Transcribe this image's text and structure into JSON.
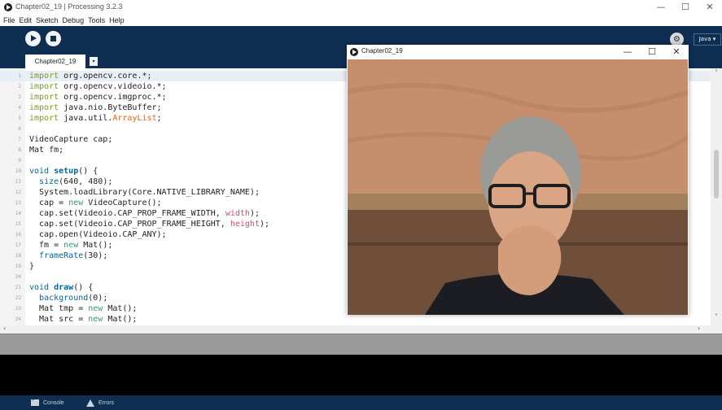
{
  "window": {
    "title": "Chapter02_19 | Processing 3.2.3",
    "controls": {
      "minimize": "—",
      "maximize": "☐",
      "close": "✕"
    }
  },
  "menu": [
    "File",
    "Edit",
    "Sketch",
    "Debug",
    "Tools",
    "Help"
  ],
  "toolbar": {
    "run_icon": "play-icon",
    "stop_icon": "stop-icon",
    "debug_icon": "debug-icon",
    "mode_label": "Java ▾"
  },
  "tabs": {
    "active": "Chapter02_19",
    "menu_arrow": "▾"
  },
  "editor": {
    "lines": [
      {
        "n": "1",
        "tokens": [
          [
            "import",
            "import"
          ],
          [
            " org.opencv.core.*;",
            ""
          ]
        ]
      },
      {
        "n": "2",
        "tokens": [
          [
            "import",
            "import"
          ],
          [
            " org.opencv.videoio.*;",
            ""
          ]
        ]
      },
      {
        "n": "3",
        "tokens": [
          [
            "import",
            "import"
          ],
          [
            " org.opencv.imgproc.*;",
            ""
          ]
        ]
      },
      {
        "n": "4",
        "tokens": [
          [
            "import",
            "import"
          ],
          [
            " java.nio.ByteBuffer;",
            ""
          ]
        ]
      },
      {
        "n": "5",
        "tokens": [
          [
            "import",
            "import"
          ],
          [
            " java.util.",
            ""
          ],
          [
            "ArrayList",
            "type"
          ],
          [
            ";",
            ""
          ]
        ]
      },
      {
        "n": "6",
        "tokens": []
      },
      {
        "n": "7",
        "tokens": [
          [
            "VideoCapture cap;",
            ""
          ]
        ]
      },
      {
        "n": "8",
        "tokens": [
          [
            "Mat fm;",
            ""
          ]
        ]
      },
      {
        "n": "9",
        "tokens": []
      },
      {
        "n": "10",
        "tokens": [
          [
            "void",
            "call"
          ],
          [
            " ",
            ""
          ],
          [
            "setup",
            "func"
          ],
          [
            "() {",
            ""
          ]
        ]
      },
      {
        "n": "11",
        "tokens": [
          [
            "  ",
            ""
          ],
          [
            "size",
            "call"
          ],
          [
            "(640, 480);",
            ""
          ]
        ]
      },
      {
        "n": "12",
        "tokens": [
          [
            "  System.loadLibrary(Core.NATIVE_LIBRARY_NAME);",
            ""
          ]
        ]
      },
      {
        "n": "13",
        "tokens": [
          [
            "  cap = ",
            ""
          ],
          [
            "new",
            "new"
          ],
          [
            " VideoCapture();",
            ""
          ]
        ]
      },
      {
        "n": "14",
        "tokens": [
          [
            "  cap.set(Videoio.CAP_PROP_FRAME_WIDTH, ",
            ""
          ],
          [
            "width",
            "special"
          ],
          [
            ");",
            ""
          ]
        ]
      },
      {
        "n": "15",
        "tokens": [
          [
            "  cap.set(Videoio.CAP_PROP_FRAME_HEIGHT, ",
            ""
          ],
          [
            "height",
            "special"
          ],
          [
            ");",
            ""
          ]
        ]
      },
      {
        "n": "16",
        "tokens": [
          [
            "  cap.open(Videoio.CAP_ANY);",
            ""
          ]
        ]
      },
      {
        "n": "17",
        "tokens": [
          [
            "  fm = ",
            ""
          ],
          [
            "new",
            "new"
          ],
          [
            " Mat();",
            ""
          ]
        ]
      },
      {
        "n": "18",
        "tokens": [
          [
            "  ",
            ""
          ],
          [
            "frameRate",
            "call"
          ],
          [
            "(30);",
            ""
          ]
        ]
      },
      {
        "n": "19",
        "tokens": [
          [
            "}",
            ""
          ]
        ]
      },
      {
        "n": "20",
        "tokens": []
      },
      {
        "n": "21",
        "tokens": [
          [
            "void",
            "call"
          ],
          [
            " ",
            ""
          ],
          [
            "draw",
            "func"
          ],
          [
            "() {",
            ""
          ]
        ]
      },
      {
        "n": "22",
        "tokens": [
          [
            "  ",
            ""
          ],
          [
            "background",
            "call"
          ],
          [
            "(0);",
            ""
          ]
        ]
      },
      {
        "n": "23",
        "tokens": [
          [
            "  Mat tmp = ",
            ""
          ],
          [
            "new",
            "new"
          ],
          [
            " Mat();",
            ""
          ]
        ]
      },
      {
        "n": "24",
        "tokens": [
          [
            "  Mat src = ",
            ""
          ],
          [
            "new",
            "new"
          ],
          [
            " Mat();",
            ""
          ]
        ]
      }
    ],
    "current_line": "1",
    "scroll_left": "‹",
    "scroll_right": "›",
    "scroll_up": "˄",
    "scroll_down": "˅"
  },
  "sketch_window": {
    "title": "Chapter02_19",
    "controls": {
      "minimize": "—",
      "maximize": "☐",
      "close": "✕"
    },
    "content": "webcam-frame"
  },
  "footer": {
    "console_label": "Console",
    "errors_label": "Errors",
    "console_icon": "console-icon",
    "errors_icon": "warning-icon"
  },
  "colors": {
    "toolbar_bg": "#0e2e52",
    "import_keyword": "#7a9a28",
    "type_keyword": "#e2661a",
    "function_keyword": "#006699",
    "special_keyword": "#d94a7a",
    "new_keyword": "#33997e"
  }
}
